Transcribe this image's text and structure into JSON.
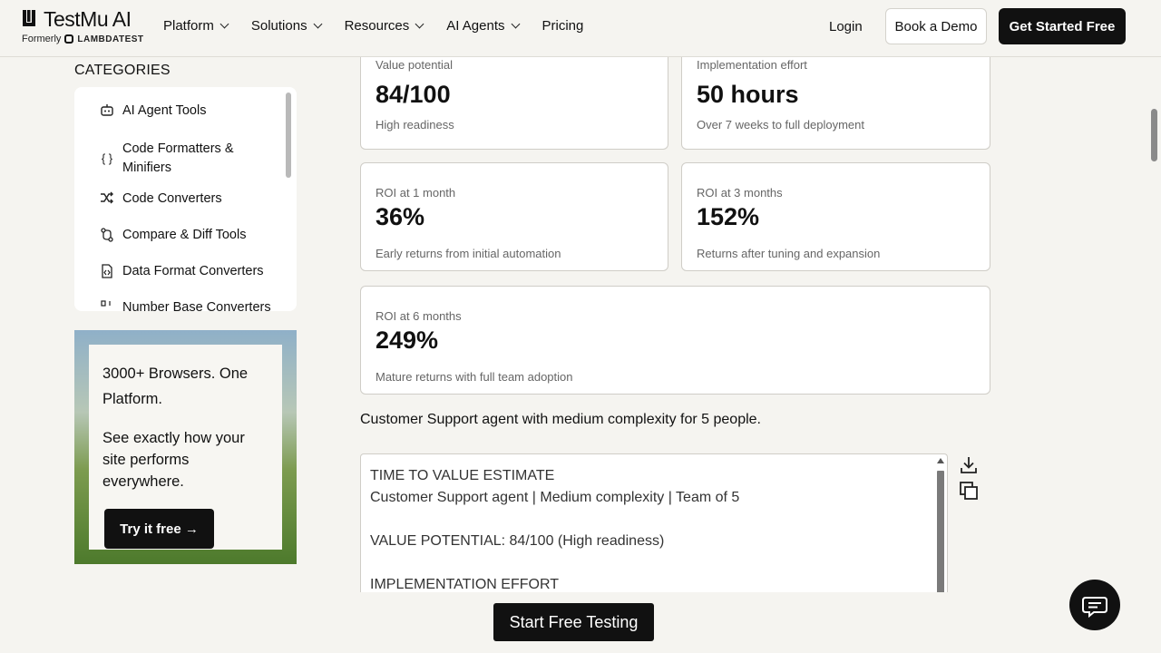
{
  "header": {
    "logo_mark": "ı",
    "logo_text": "TestMu AI",
    "formerly_label": "Formerly",
    "formerly_brand": "LAMBDATEST",
    "nav": [
      {
        "label": "Platform"
      },
      {
        "label": "Solutions"
      },
      {
        "label": "Resources"
      },
      {
        "label": "AI Agents"
      },
      {
        "label": "Pricing"
      }
    ],
    "login": "Login",
    "book_demo": "Book a Demo",
    "get_started": "Get Started Free"
  },
  "sidebar": {
    "title": "CATEGORIES",
    "items": [
      {
        "label": "AI Agent Tools",
        "icon": "robot-icon"
      },
      {
        "label": "Code Formatters & Minifiers",
        "icon": "braces-icon"
      },
      {
        "label": "Code Converters",
        "icon": "shuffle-icon"
      },
      {
        "label": "Compare & Diff Tools",
        "icon": "git-compare-icon"
      },
      {
        "label": "Data Format Converters",
        "icon": "file-code-icon"
      },
      {
        "label": "Number Base Converters",
        "icon": "binary-icon"
      }
    ]
  },
  "promo": {
    "title": "3000+ Browsers. One Platform.",
    "subtitle": "See exactly how your site performs everywhere.",
    "button": "Try it free →"
  },
  "metrics": {
    "value_potential": {
      "label": "Value potential",
      "value": "84/100",
      "note": "High readiness"
    },
    "implementation": {
      "label": "Implementation effort",
      "value": "50 hours",
      "note": "Over 7 weeks to full deployment"
    },
    "roi_1": {
      "label": "ROI at 1 month",
      "value": "36%",
      "note": "Early returns from initial automation"
    },
    "roi_3": {
      "label": "ROI at 3 months",
      "value": "152%",
      "note": "Returns after tuning and expansion"
    },
    "roi_6": {
      "label": "ROI at 6 months",
      "value": "249%",
      "note": "Mature returns with full team adoption"
    }
  },
  "summary": "Customer Support agent with medium complexity for 5 people.",
  "output": {
    "text": "TIME TO VALUE ESTIMATE\nCustomer Support agent | Medium complexity | Team of 5\n\nVALUE POTENTIAL: 84/100 (High readiness)\n\nIMPLEMENTATION EFFORT"
  },
  "bottom": {
    "start_testing": "Start Free Testing"
  }
}
